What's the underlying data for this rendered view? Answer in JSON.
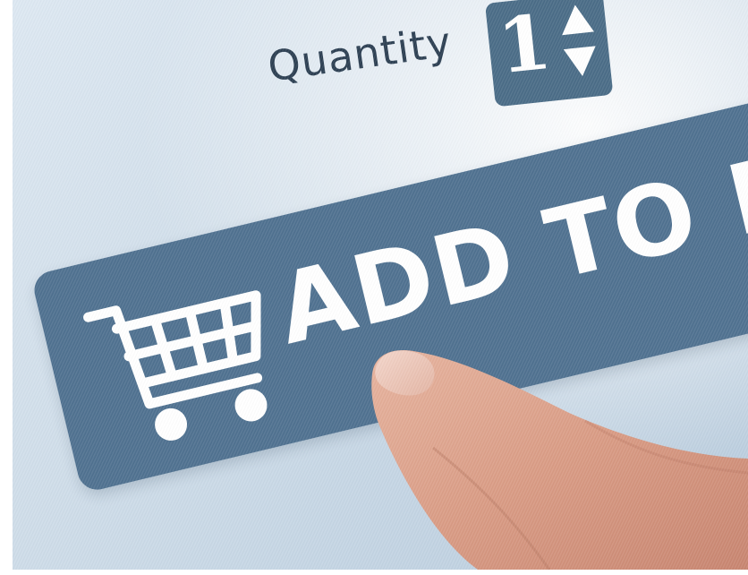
{
  "quantity": {
    "label": "Quantity",
    "value": "1"
  },
  "cart_button": {
    "label": "ADD TO BASKET"
  },
  "colors": {
    "button": "#4f7190",
    "stepper": "#4a6c87",
    "screen": "#cfdde9",
    "text_dark": "#2c3f52"
  },
  "icons": [
    "shopping-cart-icon",
    "arrow-up-icon",
    "arrow-down-icon"
  ]
}
